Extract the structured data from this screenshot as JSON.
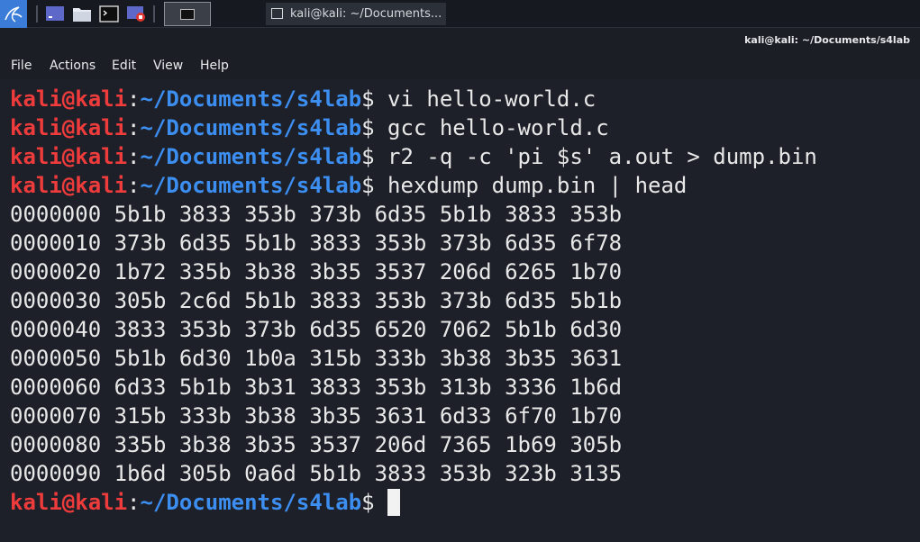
{
  "taskbar": {
    "task_title": "kali@kali: ~/Documents...",
    "launcher_icons": [
      "desktop-icon",
      "file-manager-icon",
      "terminal-icon",
      "screen-recorder-icon"
    ],
    "accent": "#3a7cd8"
  },
  "window": {
    "title": "kali@kali: ~/Documents/s4lab"
  },
  "menu": [
    {
      "label": "File"
    },
    {
      "label": "Actions"
    },
    {
      "label": "Edit"
    },
    {
      "label": "View"
    },
    {
      "label": "Help"
    }
  ],
  "prompt": {
    "user": "kali@kali",
    "colon": ":",
    "path": "~/Documents/s4lab",
    "dollar": "$",
    "user_color": "#ee3b3b",
    "path_color": "#3c8ef0"
  },
  "commands": [
    " vi hello-world.c",
    " gcc hello-world.c",
    " r2 -q -c 'pi $s' a.out > dump.bin",
    " hexdump dump.bin | head"
  ],
  "output": [
    "0000000 5b1b 3833 353b 373b 6d35 5b1b 3833 353b",
    "0000010 373b 6d35 5b1b 3833 353b 373b 6d35 6f78",
    "0000020 1b72 335b 3b38 3b35 3537 206d 6265 1b70",
    "0000030 305b 2c6d 5b1b 3833 353b 373b 6d35 5b1b",
    "0000040 3833 353b 373b 6d35 6520 7062 5b1b 6d30",
    "0000050 5b1b 6d30 1b0a 315b 333b 3b38 3b35 3631",
    "0000060 6d33 5b1b 3b31 3833 353b 313b 3336 1b6d",
    "0000070 315b 333b 3b38 3b35 3631 6d33 6f70 1b70",
    "0000080 335b 3b38 3b35 3537 206d 7365 1b69 305b",
    "0000090 1b6d 305b 0a6d 5b1b 3833 353b 323b 3135"
  ],
  "final_command": " "
}
